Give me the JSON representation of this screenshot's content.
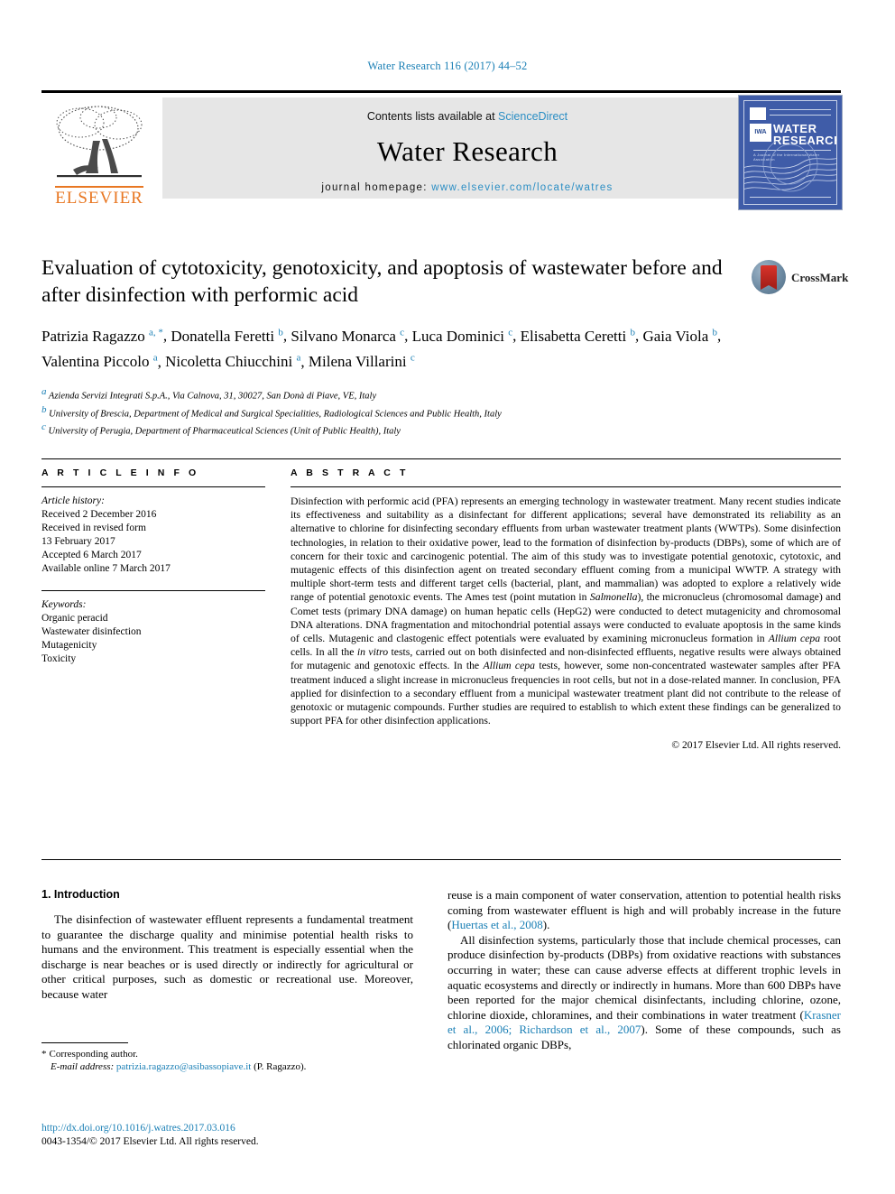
{
  "running_head": "Water Research 116 (2017) 44–52",
  "masthead": {
    "contents_prefix": "Contents lists available at",
    "sciencedirect": "ScienceDirect",
    "journal_title": "Water Research",
    "homepage_label": "journal homepage:",
    "homepage_url": "www.elsevier.com/locate/watres",
    "publisher_logo_text": "ELSEVIER",
    "cover": {
      "line1": "WATER",
      "line2": "RESEARCH",
      "society_badge": "IWA",
      "subtitle": "A Journal of the International Water Association"
    }
  },
  "article": {
    "title": "Evaluation of cytotoxicity, genotoxicity, and apoptosis of wastewater before and after disinfection with performic acid",
    "crossmark_label": "CrossMark",
    "authors": [
      {
        "name": "Patrizia Ragazzo",
        "marks": "a, *"
      },
      {
        "name": "Donatella Feretti",
        "marks": "b"
      },
      {
        "name": "Silvano Monarca",
        "marks": "c"
      },
      {
        "name": "Luca Dominici",
        "marks": "c"
      },
      {
        "name": "Elisabetta Ceretti",
        "marks": "b"
      },
      {
        "name": "Gaia Viola",
        "marks": "b"
      },
      {
        "name": "Valentina Piccolo",
        "marks": "a"
      },
      {
        "name": "Nicoletta Chiucchini",
        "marks": "a"
      },
      {
        "name": "Milena Villarini",
        "marks": "c"
      }
    ],
    "affiliations": [
      {
        "mark": "a",
        "text": "Azienda Servizi Integrati S.p.A., Via Calnova, 31, 30027, San Donà di Piave, VE, Italy"
      },
      {
        "mark": "b",
        "text": "University of Brescia, Department of Medical and Surgical Specialities, Radiological Sciences and Public Health, Italy"
      },
      {
        "mark": "c",
        "text": "University of Perugia, Department of Pharmaceutical Sciences (Unit of Public Health), Italy"
      }
    ]
  },
  "article_info": {
    "heading": "A R T I C L E  I N F O",
    "history_title": "Article history:",
    "history": [
      "Received 2 December 2016",
      "Received in revised form",
      "13 February 2017",
      "Accepted 6 March 2017",
      "Available online 7 March 2017"
    ],
    "keywords_title": "Keywords:",
    "keywords": [
      "Organic peracid",
      "Wastewater disinfection",
      "Mutagenicity",
      "Toxicity"
    ]
  },
  "abstract": {
    "heading": "A B S T R A C T",
    "paragraph_1": "Disinfection with performic acid (PFA) represents an emerging technology in wastewater treatment. Many recent studies indicate its effectiveness and suitability as a disinfectant for different applications; several have demonstrated its reliability as an alternative to chlorine for disinfecting secondary effluents from urban wastewater treatment plants (WWTPs). Some disinfection technologies, in relation to their oxidative power, lead to the formation of disinfection by-products (DBPs), some of which are of concern for their toxic and carcinogenic potential. The aim of this study was to investigate potential genotoxic, cytotoxic, and mutagenic effects of this disinfection agent on treated secondary effluent coming from a municipal WWTP. A strategy with multiple short-term tests and different target cells (bacterial, plant, and mammalian) was adopted to explore a relatively wide range of potential genotoxic events. The Ames test (point mutation in ",
    "italic_1": "Salmonella",
    "paragraph_2": "), the micronucleus (chromosomal damage) and Comet tests (primary DNA damage) on human hepatic cells (HepG2) were conducted to detect mutagenicity and chromosomal DNA alterations. DNA fragmentation and mitochondrial potential assays were conducted to evaluate apoptosis in the same kinds of cells. Mutagenic and clastogenic effect potentials were evaluated by examining micronucleus formation in ",
    "italic_2": "Allium cepa",
    "paragraph_3": " root cells. In all the ",
    "italic_3": "in vitro",
    "paragraph_4": " tests, carried out on both disinfected and non-disinfected effluents, negative results were always obtained for mutagenic and genotoxic effects. In the ",
    "italic_4": "Allium cepa",
    "paragraph_5": " tests, however, some non-concentrated wastewater samples after PFA treatment induced a slight increase in micronucleus frequencies in root cells, but not in a dose-related manner. In conclusion, PFA applied for disinfection to a secondary effluent from a municipal wastewater treatment plant did not contribute to the release of genotoxic or mutagenic compounds. Further studies are required to establish to which extent these findings can be generalized to support PFA for other disinfection applications.",
    "copyright": "© 2017 Elsevier Ltd. All rights reserved."
  },
  "introduction": {
    "heading": "1. Introduction",
    "left_para_1": "The disinfection of wastewater effluent represents a fundamental treatment to guarantee the discharge quality and minimise potential health risks to humans and the environment. This treatment is especially essential when the discharge is near beaches or is used directly or indirectly for agricultural or other critical purposes, such as domestic or recreational use. Moreover, because water",
    "right_para_1a": "reuse is a main component of water conservation, attention to potential health risks coming from wastewater effluent is high and will probably increase in the future (",
    "right_ref_1": "Huertas et al., 2008",
    "right_para_1b": ").",
    "right_para_2a": "All disinfection systems, particularly those that include chemical processes, can produce disinfection by-products (DBPs) from oxidative reactions with substances occurring in water; these can cause adverse effects at different trophic levels in aquatic ecosystems and directly or indirectly in humans. More than 600 DBPs have been reported for the major chemical disinfectants, including chlorine, ozone, chlorine dioxide, chloramines, and their combinations in water treatment (",
    "right_ref_2": "Krasner et al., 2006; Richardson et al., 2007",
    "right_para_2b": "). Some of these compounds, such as chlorinated organic DBPs,"
  },
  "footnote": {
    "star": "*",
    "corresponding": "Corresponding author.",
    "email_label": "E-mail address:",
    "email": "patrizia.ragazzo@asibassopiave.it",
    "email_suffix": "(P. Ragazzo)."
  },
  "footer": {
    "doi": "http://dx.doi.org/10.1016/j.watres.2017.03.016",
    "issn_line": "0043-1354/© 2017 Elsevier Ltd. All rights reserved."
  },
  "colors": {
    "link_blue": "#1a7fb5",
    "elsevier_orange": "#E87722",
    "band_gray": "#e6e6e6",
    "cover_blue": "#3f5ca8"
  }
}
